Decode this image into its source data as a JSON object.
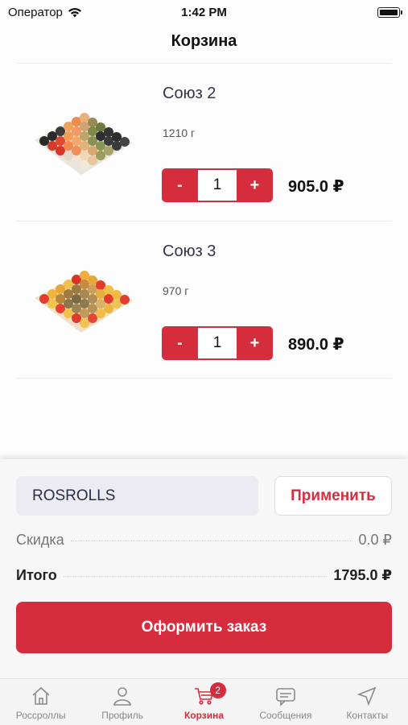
{
  "status_bar": {
    "carrier": "Оператор",
    "time": "1:42 PM"
  },
  "nav": {
    "title": "Корзина"
  },
  "products": [
    {
      "name": "Союз 2",
      "weight": "1210 г",
      "minus": "-",
      "quantity": "1",
      "plus": "+",
      "price": "905.0 ₽"
    },
    {
      "name": "Союз 3",
      "weight": "970 г",
      "minus": "-",
      "quantity": "1",
      "plus": "+",
      "price": "890.0 ₽"
    }
  ],
  "promo": {
    "code": "ROSROLLS",
    "apply_label": "Применить"
  },
  "summary": {
    "discount_label": "Скидка",
    "discount_value": "0.0 ₽",
    "total_label": "Итого",
    "total_value": "1795.0 ₽"
  },
  "order_button": "Оформить заказ",
  "tabs": [
    {
      "label": "Россроллы",
      "icon": "home-icon"
    },
    {
      "label": "Профиль",
      "icon": "profile-icon"
    },
    {
      "label": "Корзина",
      "icon": "cart-icon",
      "badge": "2",
      "active": true
    },
    {
      "label": "Сообщения",
      "icon": "messages-icon"
    },
    {
      "label": "Контакты",
      "icon": "location-arrow-icon"
    }
  ],
  "colors": {
    "accent": "#d52d3e",
    "product_name": "#34354a",
    "promo_bg": "#ebebf1"
  }
}
